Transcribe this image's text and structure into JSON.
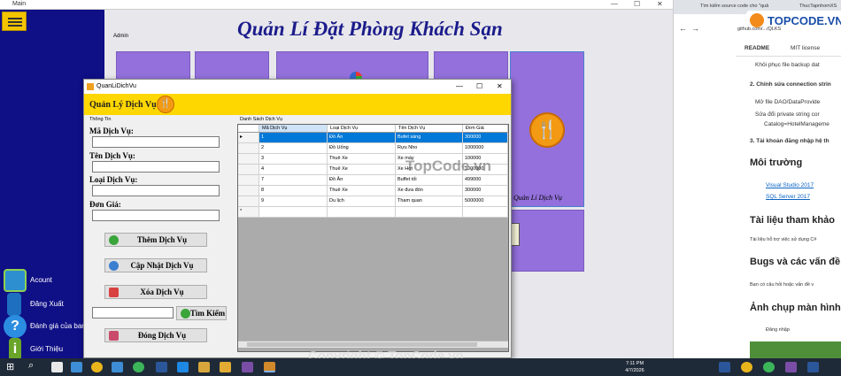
{
  "main_window": {
    "title": "Main",
    "controls": [
      "—",
      "☐",
      "✕"
    ]
  },
  "header": {
    "title": "Quản Lí Đặt Phòng Khách Sạn",
    "user": "Admin"
  },
  "sidebar": {
    "items": [
      {
        "label": "Acount",
        "icon": "user-icon"
      },
      {
        "label": "Đăng Xuất",
        "icon": "logout-icon"
      },
      {
        "label": "Đánh giá của ban",
        "icon": "help-icon"
      },
      {
        "label": "Giới Thiệu",
        "icon": "info-icon"
      }
    ]
  },
  "tiles": {
    "service_tile_label": "Quản Lí Dịch Vụ"
  },
  "dialog": {
    "title": "QuanLiDichVu",
    "controls": [
      "—",
      "☐",
      "✕"
    ],
    "header": "Quản Lý Dịch Vụ:",
    "info_group": "Thông Tin",
    "grid_group": "Danh Sách Dịch Vụ",
    "fields": {
      "ma_label": "Mã Dịch Vụ:",
      "ten_label": "Tên Dịch Vụ:",
      "loai_label": "Loại Dịch Vụ:",
      "gia_label": "Đơn Giá:"
    },
    "buttons": {
      "them": "Thêm Dịch Vụ",
      "capnhat": "Cập Nhật Dịch Vụ",
      "xoa": "Xóa Dịch Vụ",
      "timkiem": "Tìm Kiếm",
      "dong": "Đóng Dịch Vụ"
    },
    "grid": {
      "columns": [
        "Mã Dịch Vụ",
        "Loại Dịch Vụ",
        "Tên Dịch Vụ",
        "Đơn Giá"
      ],
      "rows": [
        [
          "1",
          "Đồ Ăn",
          "Bufet sáng",
          "300000"
        ],
        [
          "2",
          "Đồ Uống",
          "Rựu Nho",
          "1000000"
        ],
        [
          "3",
          "Thuê Xe",
          "Xe máy",
          "100000"
        ],
        [
          "4",
          "Thuê Xe",
          "Xe Hơi",
          "1000000"
        ],
        [
          "7",
          "Đồ Ăn",
          "Buffet tối",
          "499000"
        ],
        [
          "8",
          "Thuê Xe",
          "Xe đưa đón",
          "300000"
        ],
        [
          "9",
          "Du lịch",
          "Tham quan",
          "5000000"
        ]
      ]
    }
  },
  "browser": {
    "tab_title": "Tìm kiếm source code cho \"quả",
    "tab2_title": "ThucTapnhomXS",
    "logo": "TOPCODE.VN",
    "url_fragment": "github.com/.../QLKS",
    "readme_tab": "README",
    "license_tab": "MIT license",
    "lines": [
      "Khôi phục file backup dat",
      "2. Chỉnh sửa connection strin",
      "Mở file DAO/DataProvide",
      "Sửa đổi private string cor",
      "Catalog=HotelManageme",
      "3. Tài khoản đăng nhập hệ th"
    ],
    "env_heading": "Môi trường",
    "env_links": [
      "Visual Studio 2017",
      "SQL Server 2017"
    ],
    "docs_heading": "Tài liệu tham khảo",
    "docs_text": "Tài liệu hỗ trợ việc sử dụng C#",
    "bugs_heading": "Bugs và các vấn đề",
    "bugs_text": "Bạn có câu hỏi hoặc vấn đề v",
    "shots_heading": "Ảnh chụp màn hình",
    "shots_item": "Đăng nhập"
  },
  "taskbar": {
    "time": "7:11 PM",
    "date": "4/7/2026"
  },
  "watermarks": {
    "center": "TopCode.vn",
    "bottom": "Copyright © TopCode.vn"
  }
}
